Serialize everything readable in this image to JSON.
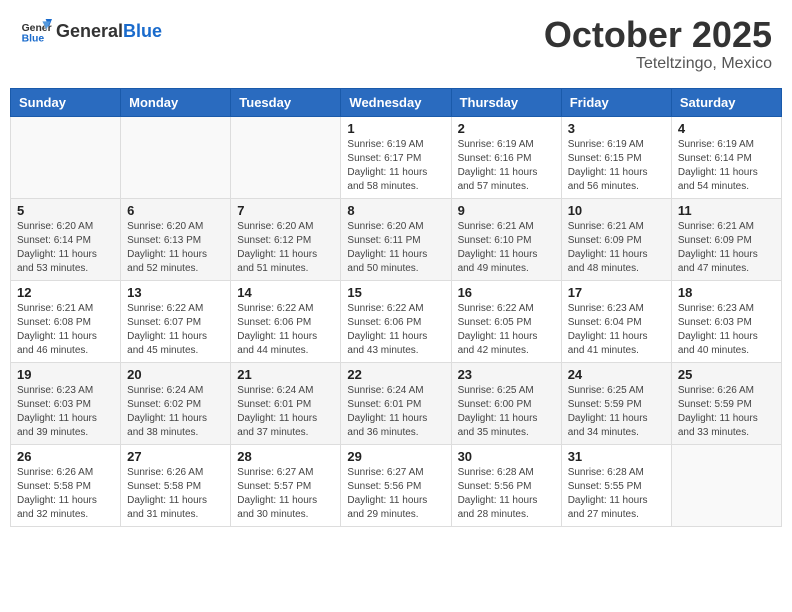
{
  "header": {
    "logo_general": "General",
    "logo_blue": "Blue",
    "month_title": "October 2025",
    "location": "Teteltzingo, Mexico"
  },
  "weekdays": [
    "Sunday",
    "Monday",
    "Tuesday",
    "Wednesday",
    "Thursday",
    "Friday",
    "Saturday"
  ],
  "weeks": [
    [
      {
        "day": "",
        "info": ""
      },
      {
        "day": "",
        "info": ""
      },
      {
        "day": "",
        "info": ""
      },
      {
        "day": "1",
        "info": "Sunrise: 6:19 AM\nSunset: 6:17 PM\nDaylight: 11 hours and 58 minutes."
      },
      {
        "day": "2",
        "info": "Sunrise: 6:19 AM\nSunset: 6:16 PM\nDaylight: 11 hours and 57 minutes."
      },
      {
        "day": "3",
        "info": "Sunrise: 6:19 AM\nSunset: 6:15 PM\nDaylight: 11 hours and 56 minutes."
      },
      {
        "day": "4",
        "info": "Sunrise: 6:19 AM\nSunset: 6:14 PM\nDaylight: 11 hours and 54 minutes."
      }
    ],
    [
      {
        "day": "5",
        "info": "Sunrise: 6:20 AM\nSunset: 6:14 PM\nDaylight: 11 hours and 53 minutes."
      },
      {
        "day": "6",
        "info": "Sunrise: 6:20 AM\nSunset: 6:13 PM\nDaylight: 11 hours and 52 minutes."
      },
      {
        "day": "7",
        "info": "Sunrise: 6:20 AM\nSunset: 6:12 PM\nDaylight: 11 hours and 51 minutes."
      },
      {
        "day": "8",
        "info": "Sunrise: 6:20 AM\nSunset: 6:11 PM\nDaylight: 11 hours and 50 minutes."
      },
      {
        "day": "9",
        "info": "Sunrise: 6:21 AM\nSunset: 6:10 PM\nDaylight: 11 hours and 49 minutes."
      },
      {
        "day": "10",
        "info": "Sunrise: 6:21 AM\nSunset: 6:09 PM\nDaylight: 11 hours and 48 minutes."
      },
      {
        "day": "11",
        "info": "Sunrise: 6:21 AM\nSunset: 6:09 PM\nDaylight: 11 hours and 47 minutes."
      }
    ],
    [
      {
        "day": "12",
        "info": "Sunrise: 6:21 AM\nSunset: 6:08 PM\nDaylight: 11 hours and 46 minutes."
      },
      {
        "day": "13",
        "info": "Sunrise: 6:22 AM\nSunset: 6:07 PM\nDaylight: 11 hours and 45 minutes."
      },
      {
        "day": "14",
        "info": "Sunrise: 6:22 AM\nSunset: 6:06 PM\nDaylight: 11 hours and 44 minutes."
      },
      {
        "day": "15",
        "info": "Sunrise: 6:22 AM\nSunset: 6:06 PM\nDaylight: 11 hours and 43 minutes."
      },
      {
        "day": "16",
        "info": "Sunrise: 6:22 AM\nSunset: 6:05 PM\nDaylight: 11 hours and 42 minutes."
      },
      {
        "day": "17",
        "info": "Sunrise: 6:23 AM\nSunset: 6:04 PM\nDaylight: 11 hours and 41 minutes."
      },
      {
        "day": "18",
        "info": "Sunrise: 6:23 AM\nSunset: 6:03 PM\nDaylight: 11 hours and 40 minutes."
      }
    ],
    [
      {
        "day": "19",
        "info": "Sunrise: 6:23 AM\nSunset: 6:03 PM\nDaylight: 11 hours and 39 minutes."
      },
      {
        "day": "20",
        "info": "Sunrise: 6:24 AM\nSunset: 6:02 PM\nDaylight: 11 hours and 38 minutes."
      },
      {
        "day": "21",
        "info": "Sunrise: 6:24 AM\nSunset: 6:01 PM\nDaylight: 11 hours and 37 minutes."
      },
      {
        "day": "22",
        "info": "Sunrise: 6:24 AM\nSunset: 6:01 PM\nDaylight: 11 hours and 36 minutes."
      },
      {
        "day": "23",
        "info": "Sunrise: 6:25 AM\nSunset: 6:00 PM\nDaylight: 11 hours and 35 minutes."
      },
      {
        "day": "24",
        "info": "Sunrise: 6:25 AM\nSunset: 5:59 PM\nDaylight: 11 hours and 34 minutes."
      },
      {
        "day": "25",
        "info": "Sunrise: 6:26 AM\nSunset: 5:59 PM\nDaylight: 11 hours and 33 minutes."
      }
    ],
    [
      {
        "day": "26",
        "info": "Sunrise: 6:26 AM\nSunset: 5:58 PM\nDaylight: 11 hours and 32 minutes."
      },
      {
        "day": "27",
        "info": "Sunrise: 6:26 AM\nSunset: 5:58 PM\nDaylight: 11 hours and 31 minutes."
      },
      {
        "day": "28",
        "info": "Sunrise: 6:27 AM\nSunset: 5:57 PM\nDaylight: 11 hours and 30 minutes."
      },
      {
        "day": "29",
        "info": "Sunrise: 6:27 AM\nSunset: 5:56 PM\nDaylight: 11 hours and 29 minutes."
      },
      {
        "day": "30",
        "info": "Sunrise: 6:28 AM\nSunset: 5:56 PM\nDaylight: 11 hours and 28 minutes."
      },
      {
        "day": "31",
        "info": "Sunrise: 6:28 AM\nSunset: 5:55 PM\nDaylight: 11 hours and 27 minutes."
      },
      {
        "day": "",
        "info": ""
      }
    ]
  ]
}
